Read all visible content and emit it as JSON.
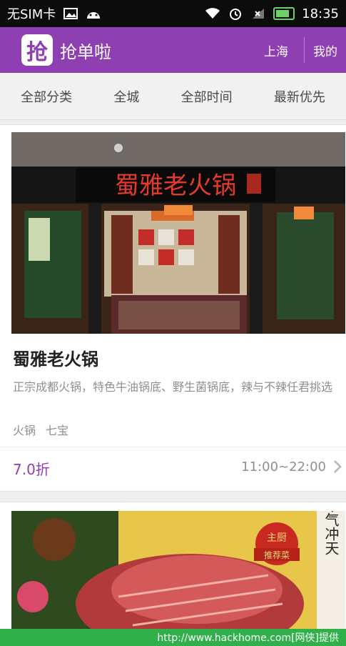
{
  "status_bar": {
    "carrier": "无SIM卡",
    "time": "18:35",
    "icons": [
      "image-icon",
      "android-icon",
      "wifi-icon",
      "alarm-icon",
      "signal-icon",
      "battery-icon"
    ]
  },
  "app_bar": {
    "logo_char": "抢",
    "title": "抢单啦",
    "city": "上海",
    "mine": "我的",
    "colors": {
      "accent": "#8e3fb2"
    }
  },
  "filters": [
    {
      "label": "全部分类"
    },
    {
      "label": "全城"
    },
    {
      "label": "全部时间"
    },
    {
      "label": "最新优先"
    }
  ],
  "listings": [
    {
      "sign_text": "蜀雅老火锅",
      "name": "蜀雅老火锅",
      "description": "正宗成都火锅，特色牛油锅底、野生菌锅底，辣与不辣任君挑选",
      "tags": [
        "火锅",
        "七宝"
      ],
      "discount": "7.0折",
      "hours": "11:00~22:00"
    },
    {
      "badge_top": "主厨",
      "badge_bottom": "推荐菜",
      "side_text": "牛气冲天"
    }
  ],
  "watermark": "http://www.hackhome.com[网侠]提供"
}
